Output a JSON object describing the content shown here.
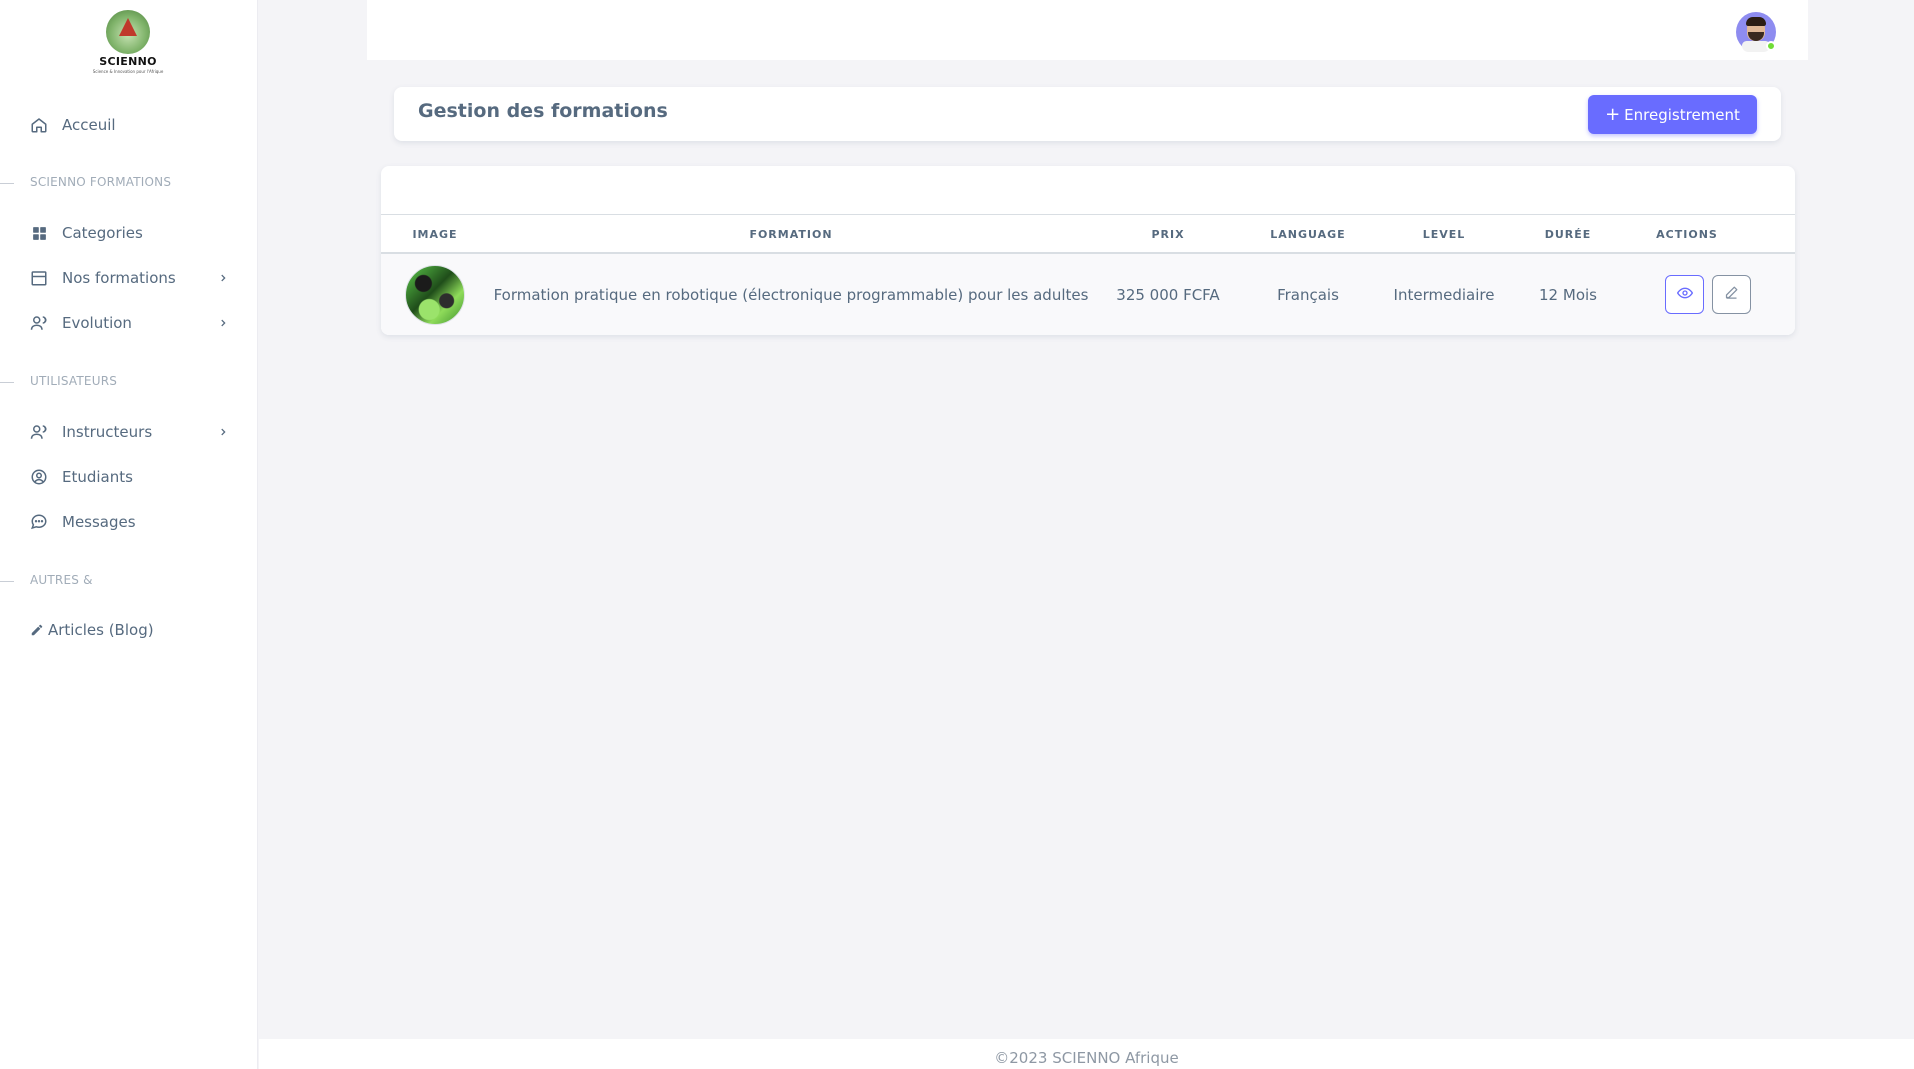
{
  "brand": {
    "name": "SCIENNO",
    "tagline": "Science & Innovation pour l'Afrique"
  },
  "sidebar": {
    "items": [
      {
        "label": "Acceuil",
        "icon": "home-icon"
      },
      {
        "label": "Categories",
        "icon": "grid-icon"
      },
      {
        "label": "Nos formations",
        "icon": "calendar-icon",
        "has_submenu": true
      },
      {
        "label": "Evolution",
        "icon": "users-icon",
        "has_submenu": true
      },
      {
        "label": "Instructeurs",
        "icon": "users-icon",
        "has_submenu": true
      },
      {
        "label": "Etudiants",
        "icon": "user-circle-icon"
      },
      {
        "label": "Messages",
        "icon": "chat-icon"
      },
      {
        "label": "Articles (Blog)",
        "icon": "edit-icon"
      }
    ],
    "sections": [
      {
        "label": "SCIENNO FORMATIONS"
      },
      {
        "label": "UTILISATEURS"
      },
      {
        "label": "AUTRES &"
      }
    ]
  },
  "header": {
    "title": "Gestion des formations",
    "button_label": "Enregistrement"
  },
  "table": {
    "columns": [
      "IMAGE",
      "FORMATION",
      "PRIX",
      "LANGUAGE",
      "LEVEL",
      "DURÉE",
      "ACTIONS"
    ],
    "rows": [
      {
        "formation": "Formation pratique en robotique (électronique programmable) pour les adultes",
        "prix": "325 000 FCFA",
        "language": "Français",
        "level": "Intermediaire",
        "duree": "12 Mois"
      }
    ]
  },
  "footer": {
    "text": "©2023 SCIENNO Afrique"
  },
  "colors": {
    "primary": "#696cff",
    "text": "#566a7f",
    "muted": "#a1acb8",
    "background": "#f4f4f7",
    "online": "#71dd37"
  }
}
